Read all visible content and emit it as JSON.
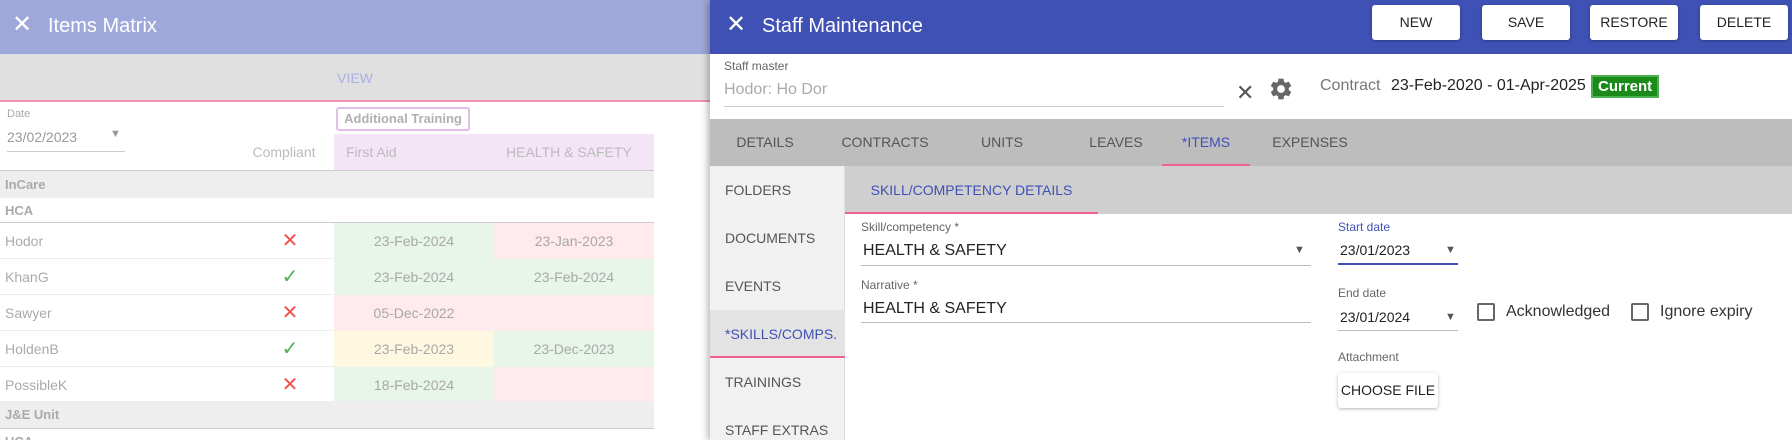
{
  "matrix": {
    "title": "Items Matrix",
    "close_icon": "✕",
    "view_label": "VIEW",
    "date_label": "Date",
    "date_value": "23/02/2023",
    "caret": "▼",
    "group_label": "Additional Training",
    "columns": {
      "compliant": "Compliant",
      "first_aid": "First Aid",
      "health_safety": "HEALTH & SAFETY"
    },
    "groups": {
      "incare": "InCare",
      "hca": "HCA",
      "je_unit": "J&E Unit",
      "uca": "UCA"
    },
    "rows": [
      {
        "name": "Hodor",
        "mark": "✕",
        "first_aid": "23-Feb-2024",
        "health_safety": "23-Jan-2023"
      },
      {
        "name": "KhanG",
        "mark": "✓",
        "first_aid": "23-Feb-2024",
        "health_safety": "23-Feb-2024"
      },
      {
        "name": "Sawyer",
        "mark": "✕",
        "first_aid": "05-Dec-2022",
        "health_safety": ""
      },
      {
        "name": "HoldenB",
        "mark": "✓",
        "first_aid": "23-Feb-2023",
        "health_safety": "23-Dec-2023"
      },
      {
        "name": "PossibleK",
        "mark": "✕",
        "first_aid": "18-Feb-2024",
        "health_safety": ""
      }
    ],
    "colors": {
      "header": "#9fa8da",
      "green_cell": "#e8f5e9",
      "red_cell": "#ffebee",
      "yellow_cell": "#fff8e1",
      "cross": "#ef5350",
      "check": "#4caf50"
    }
  },
  "staff": {
    "title": "Staff Maintenance",
    "close_icon": "✕",
    "buttons": {
      "new": "NEW",
      "save": "SAVE",
      "restore": "RESTORE",
      "delete": "DELETE"
    },
    "staff_master_label": "Staff master",
    "staff_master_value": "Hodor: Ho Dor",
    "clear_icon": "✕",
    "settings_icon": "gear-icon",
    "contract_label": "Contract",
    "contract_value": "23-Feb-2020 - 01-Apr-2025",
    "contract_status": "Current",
    "tabs": {
      "details": "DETAILS",
      "contracts": "CONTRACTS",
      "units": "UNITS",
      "leaves": "LEAVES",
      "items": "*ITEMS",
      "expenses": "EXPENSES"
    },
    "side_nav": {
      "folders": "FOLDERS",
      "documents": "DOCUMENTS",
      "events": "EVENTS",
      "skills": "*SKILLS/COMPS.",
      "trainings": "TRAININGS",
      "extras": "STAFF EXTRAS"
    },
    "sub_tab": "SKILL/COMPETENCY DETAILS",
    "form": {
      "skill_label": "Skill/competency *",
      "skill_value": "HEALTH & SAFETY",
      "narrative_label": "Narrative *",
      "narrative_value": "HEALTH & SAFETY",
      "start_label": "Start date",
      "start_value": "23/01/2023",
      "end_label": "End date",
      "end_value": "23/01/2024",
      "acknowledged_label": "Acknowledged",
      "ignore_expiry_label": "Ignore expiry",
      "attachment_label": "Attachment",
      "choose_file": "CHOOSE FILE",
      "caret": "▼"
    },
    "colors": {
      "header": "#3f51b5",
      "accent": "#f06292",
      "badge": "#1b8a1b"
    }
  }
}
